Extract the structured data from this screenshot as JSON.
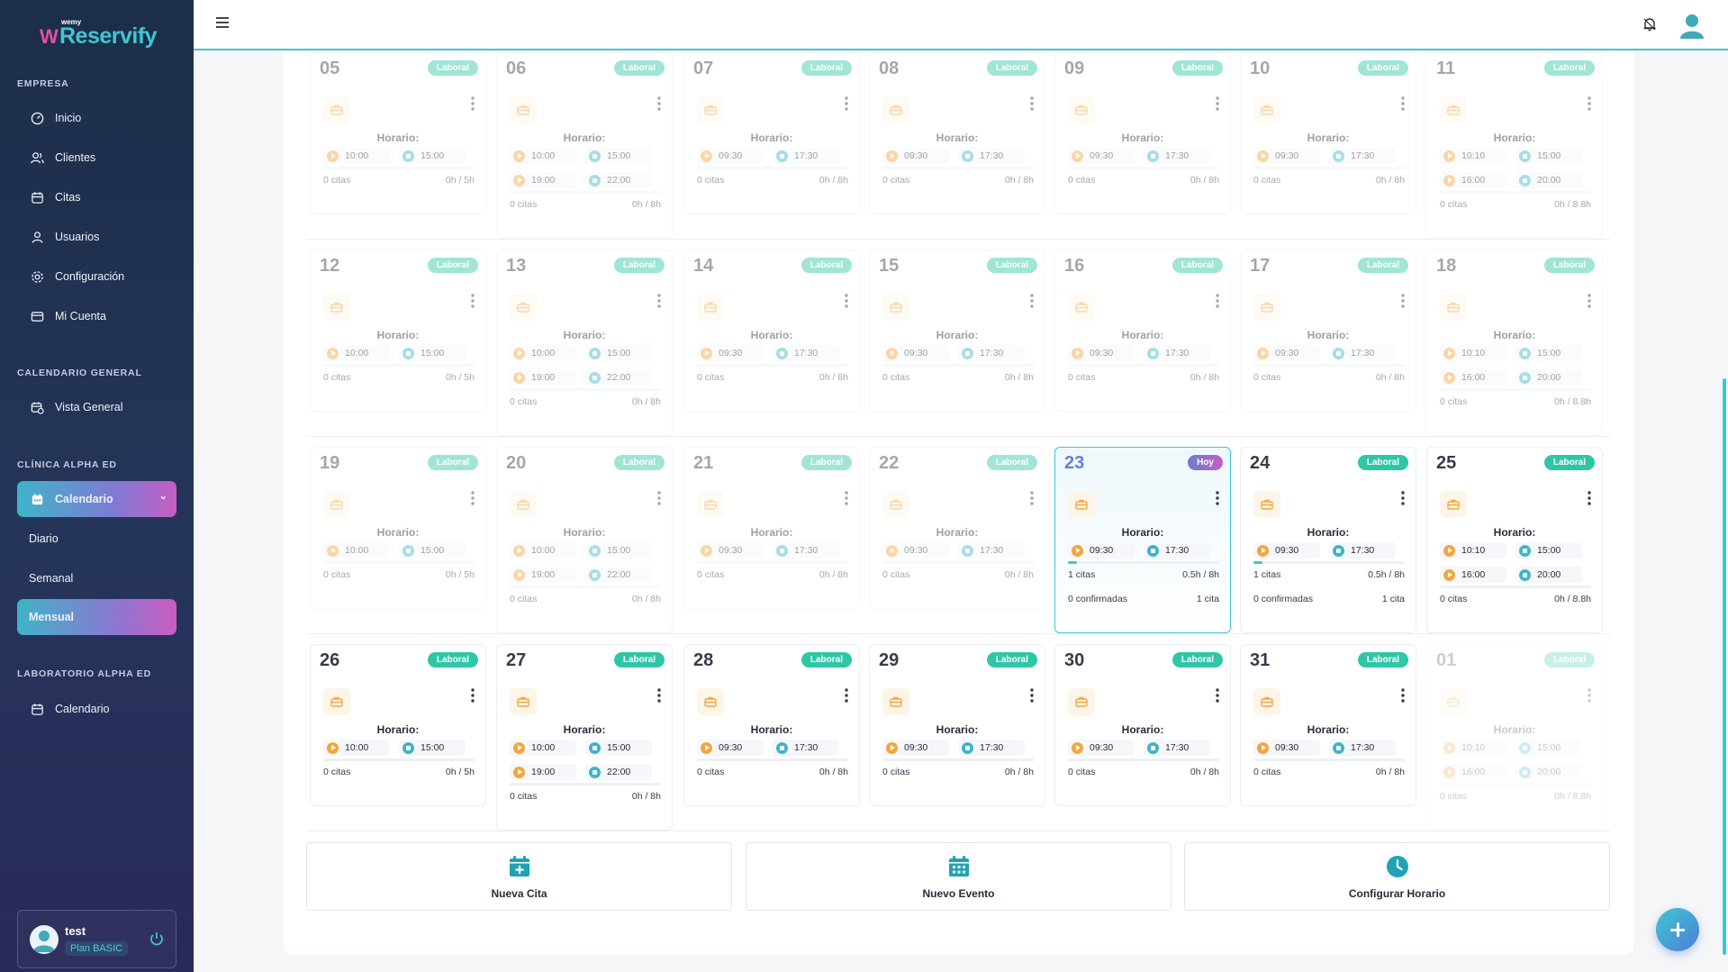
{
  "brand": {
    "sub": "wemy",
    "letter": "W",
    "name": "Reservify"
  },
  "sidebar": {
    "sections": [
      {
        "title": "EMPRESA",
        "items": [
          "Inicio",
          "Clientes",
          "Citas",
          "Usuarios",
          "Configuración",
          "Mi Cuenta"
        ]
      },
      {
        "title": "CALENDARIO GENERAL",
        "items": [
          "Vista General"
        ]
      },
      {
        "title": "CLÍNICA ALPHA ED",
        "items": [
          "Calendario"
        ],
        "subitems": [
          "Diario",
          "Semanal",
          "Mensual"
        ]
      },
      {
        "title": "LABORATORIO ALPHA ED",
        "items": [
          "Calendario"
        ]
      }
    ],
    "user": {
      "name": "test",
      "plan": "Plan BASIC"
    }
  },
  "labels": {
    "horario": "Horario:"
  },
  "actions": [
    "Nueva Cita",
    "Nuevo Evento",
    "Configurar Horario"
  ],
  "colors": {
    "accent": "#3fc6d3",
    "badge": "#2ec7a6",
    "start": "#f4a63c",
    "end": "#3fb4c8"
  },
  "weeks": [
    [
      {
        "day": "05",
        "badge": "Laboral",
        "slots": [
          [
            "10:00",
            "15:00"
          ]
        ],
        "citas": "0 citas",
        "hours": "0h / 5h",
        "state": "faded"
      },
      {
        "day": "06",
        "badge": "Laboral",
        "slots": [
          [
            "10:00",
            "15:00"
          ],
          [
            "19:00",
            "22:00"
          ]
        ],
        "citas": "0 citas",
        "hours": "0h / 8h",
        "state": "faded"
      },
      {
        "day": "07",
        "badge": "Laboral",
        "slots": [
          [
            "09:30",
            "17:30"
          ]
        ],
        "citas": "0 citas",
        "hours": "0h / 8h",
        "state": "faded"
      },
      {
        "day": "08",
        "badge": "Laboral",
        "slots": [
          [
            "09:30",
            "17:30"
          ]
        ],
        "citas": "0 citas",
        "hours": "0h / 8h",
        "state": "faded"
      },
      {
        "day": "09",
        "badge": "Laboral",
        "slots": [
          [
            "09:30",
            "17:30"
          ]
        ],
        "citas": "0 citas",
        "hours": "0h / 8h",
        "state": "faded"
      },
      {
        "day": "10",
        "badge": "Laboral",
        "slots": [
          [
            "09:30",
            "17:30"
          ]
        ],
        "citas": "0 citas",
        "hours": "0h / 8h",
        "state": "faded"
      },
      {
        "day": "11",
        "badge": "Laboral",
        "slots": [
          [
            "10:10",
            "15:00"
          ],
          [
            "16:00",
            "20:00"
          ]
        ],
        "citas": "0 citas",
        "hours": "0h / 8.8h",
        "state": "faded"
      }
    ],
    [
      {
        "day": "12",
        "badge": "Laboral",
        "slots": [
          [
            "10:00",
            "15:00"
          ]
        ],
        "citas": "0 citas",
        "hours": "0h / 5h",
        "state": "faded"
      },
      {
        "day": "13",
        "badge": "Laboral",
        "slots": [
          [
            "10:00",
            "15:00"
          ],
          [
            "19:00",
            "22:00"
          ]
        ],
        "citas": "0 citas",
        "hours": "0h / 8h",
        "state": "faded"
      },
      {
        "day": "14",
        "badge": "Laboral",
        "slots": [
          [
            "09:30",
            "17:30"
          ]
        ],
        "citas": "0 citas",
        "hours": "0h / 8h",
        "state": "faded"
      },
      {
        "day": "15",
        "badge": "Laboral",
        "slots": [
          [
            "09:30",
            "17:30"
          ]
        ],
        "citas": "0 citas",
        "hours": "0h / 8h",
        "state": "faded"
      },
      {
        "day": "16",
        "badge": "Laboral",
        "slots": [
          [
            "09:30",
            "17:30"
          ]
        ],
        "citas": "0 citas",
        "hours": "0h / 8h",
        "state": "faded"
      },
      {
        "day": "17",
        "badge": "Laboral",
        "slots": [
          [
            "09:30",
            "17:30"
          ]
        ],
        "citas": "0 citas",
        "hours": "0h / 8h",
        "state": "faded"
      },
      {
        "day": "18",
        "badge": "Laboral",
        "slots": [
          [
            "10:10",
            "15:00"
          ],
          [
            "16:00",
            "20:00"
          ]
        ],
        "citas": "0 citas",
        "hours": "0h / 8.8h",
        "state": "faded"
      }
    ],
    [
      {
        "day": "19",
        "badge": "Laboral",
        "slots": [
          [
            "10:00",
            "15:00"
          ]
        ],
        "citas": "0 citas",
        "hours": "0h / 5h",
        "state": "faded"
      },
      {
        "day": "20",
        "badge": "Laboral",
        "slots": [
          [
            "10:00",
            "15:00"
          ],
          [
            "19:00",
            "22:00"
          ]
        ],
        "citas": "0 citas",
        "hours": "0h / 8h",
        "state": "faded"
      },
      {
        "day": "21",
        "badge": "Laboral",
        "slots": [
          [
            "09:30",
            "17:30"
          ]
        ],
        "citas": "0 citas",
        "hours": "0h / 8h",
        "state": "faded"
      },
      {
        "day": "22",
        "badge": "Laboral",
        "slots": [
          [
            "09:30",
            "17:30"
          ]
        ],
        "citas": "0 citas",
        "hours": "0h / 8h",
        "state": "faded"
      },
      {
        "day": "23",
        "badge": "Hoy",
        "slots": [
          [
            "09:30",
            "17:30"
          ]
        ],
        "citas": "1 citas",
        "hours": "0.5h / 8h",
        "progress": 0.06,
        "extra": [
          "0 confirmadas",
          "1 cita"
        ],
        "state": "today"
      },
      {
        "day": "24",
        "badge": "Laboral",
        "slots": [
          [
            "09:30",
            "17:30"
          ]
        ],
        "citas": "1 citas",
        "hours": "0.5h / 8h",
        "progress": 0.06,
        "extra": [
          "0 confirmadas",
          "1 cita"
        ],
        "state": "normal"
      },
      {
        "day": "25",
        "badge": "Laboral",
        "slots": [
          [
            "10:10",
            "15:00"
          ],
          [
            "16:00",
            "20:00"
          ]
        ],
        "citas": "0 citas",
        "hours": "0h / 8.8h",
        "state": "normal"
      }
    ],
    [
      {
        "day": "26",
        "badge": "Laboral",
        "slots": [
          [
            "10:00",
            "15:00"
          ]
        ],
        "citas": "0 citas",
        "hours": "0h / 5h",
        "state": "normal"
      },
      {
        "day": "27",
        "badge": "Laboral",
        "slots": [
          [
            "10:00",
            "15:00"
          ],
          [
            "19:00",
            "22:00"
          ]
        ],
        "citas": "0 citas",
        "hours": "0h / 8h",
        "state": "normal"
      },
      {
        "day": "28",
        "badge": "Laboral",
        "slots": [
          [
            "09:30",
            "17:30"
          ]
        ],
        "citas": "0 citas",
        "hours": "0h / 8h",
        "state": "normal"
      },
      {
        "day": "29",
        "badge": "Laboral",
        "slots": [
          [
            "09:30",
            "17:30"
          ]
        ],
        "citas": "0 citas",
        "hours": "0h / 8h",
        "state": "normal"
      },
      {
        "day": "30",
        "badge": "Laboral",
        "slots": [
          [
            "09:30",
            "17:30"
          ]
        ],
        "citas": "0 citas",
        "hours": "0h / 8h",
        "state": "normal"
      },
      {
        "day": "31",
        "badge": "Laboral",
        "slots": [
          [
            "09:30",
            "17:30"
          ]
        ],
        "citas": "0 citas",
        "hours": "0h / 8h",
        "state": "normal"
      },
      {
        "day": "01",
        "badge": "Laboral",
        "slots": [
          [
            "10:10",
            "15:00"
          ],
          [
            "16:00",
            "20:00"
          ]
        ],
        "citas": "0 citas",
        "hours": "0h / 8.8h",
        "state": "veryfaded"
      }
    ]
  ]
}
